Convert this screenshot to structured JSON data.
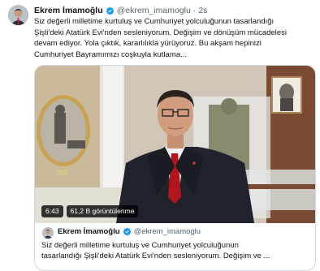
{
  "tweet": {
    "author_name": "Ekrem İmamoğlu",
    "handle": "@ekrem_imamoglu",
    "separator": "·",
    "time": "2s",
    "text_lines": [
      "Siz değerli milletime kurtuluş ve Cumhuriyet yolculuğunun tasarlandığı",
      "Şişli'deki Atatürk Evi'nden sesleniyorum. Değişim ve dönüşüm mücadelesi",
      "devam ediyor. Yola çıktık, kararlılıkla yürüyoruz. Bu akşam hepinizi",
      "Cumhuriyet Bayramımızı coşkuyla kutlama..."
    ]
  },
  "video": {
    "duration": "6:43",
    "views": "61,2 B görüntülenme"
  },
  "quoted": {
    "author_name": "Ekrem İmamoğlu",
    "handle": "@ekrem_imamoglu",
    "text_lines": [
      "Siz değerli milletime kurtuluş ve Cumhuriyet yolculuğunun",
      "tasarlandığı Şişli'deki Atatürk Evi'nden sesleniyorum. Değişim ve ..."
    ]
  },
  "colors": {
    "verified": "#1d9bf0",
    "text": "#0f1419",
    "muted": "#536471",
    "border": "#cfd9de"
  }
}
